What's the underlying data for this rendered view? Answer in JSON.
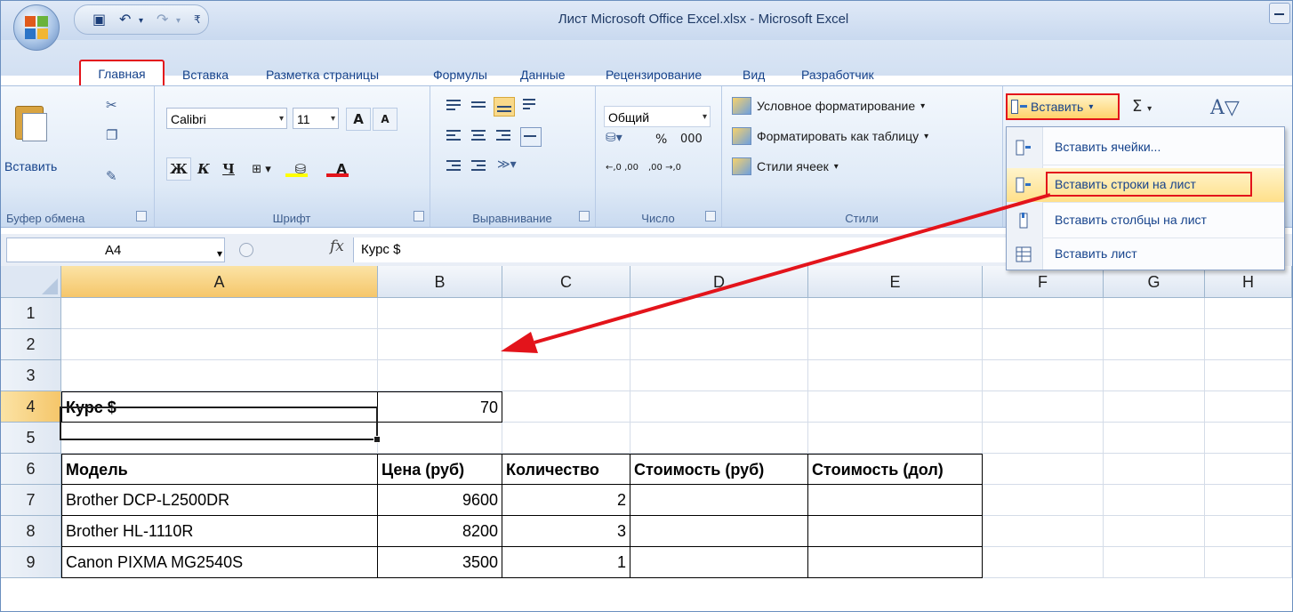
{
  "window": {
    "title": "Лист Microsoft Office Excel.xlsx - Microsoft Excel"
  },
  "ribbon_tabs": {
    "active": "Главная",
    "others": [
      "Вставка",
      "Разметка страницы",
      "Формулы",
      "Данные",
      "Рецензирование",
      "Вид",
      "Разработчик"
    ]
  },
  "clipboard": {
    "paste_label": "Вставить",
    "group_label": "Буфер обмена"
  },
  "font": {
    "name": "Calibri",
    "size": "11",
    "bold": "Ж",
    "italic": "К",
    "underline": "Ч",
    "grow": "A",
    "shrink": "A",
    "font_color_glyph": "A",
    "group_label": "Шрифт"
  },
  "alignment": {
    "group_label": "Выравнивание"
  },
  "number": {
    "format": "Общий",
    "percent": "%",
    "thousands": "000",
    "inc_decimal": "←,0 ,00",
    "dec_decimal": ",00 →,0",
    "group_label": "Число"
  },
  "styles": {
    "conditional": "Условное форматирование",
    "format_table": "Форматировать как таблицу",
    "cell_styles": "Стили ячеек",
    "group_label": "Стили"
  },
  "cells_group": {
    "insert_label": "Вставить"
  },
  "editing": {
    "sum": "Σ"
  },
  "insert_menu": {
    "items": [
      "Вставить ячейки...",
      "Вставить строки на лист",
      "Вставить столбцы на лист",
      "Вставить лист"
    ],
    "highlighted_index": 1
  },
  "formula_bar": {
    "name_box": "A4",
    "fx": "fx",
    "content": "Курс $"
  },
  "sheet": {
    "columns": [
      "A",
      "B",
      "C",
      "D",
      "E",
      "F",
      "G",
      "H"
    ],
    "rows": [
      "1",
      "2",
      "3",
      "4",
      "5",
      "6",
      "7",
      "8",
      "9"
    ],
    "active_cell": "A4",
    "rate": {
      "label": "Курс $",
      "value": "70"
    },
    "headers": [
      "Модель",
      "Цена (руб)",
      "Количество",
      "Стоимость (руб)",
      "Стоимость (дол)"
    ],
    "data": [
      [
        "Brother DCP-L2500DR",
        "9600",
        "2",
        "",
        ""
      ],
      [
        "Brother HL-1110R",
        "8200",
        "3",
        "",
        ""
      ],
      [
        "Canon PIXMA MG2540S",
        "3500",
        "1",
        "",
        ""
      ]
    ]
  },
  "colors": {
    "highlight_red": "#e3141b",
    "ribbon_text": "#15428b",
    "selected_header": "#f5c66a"
  }
}
